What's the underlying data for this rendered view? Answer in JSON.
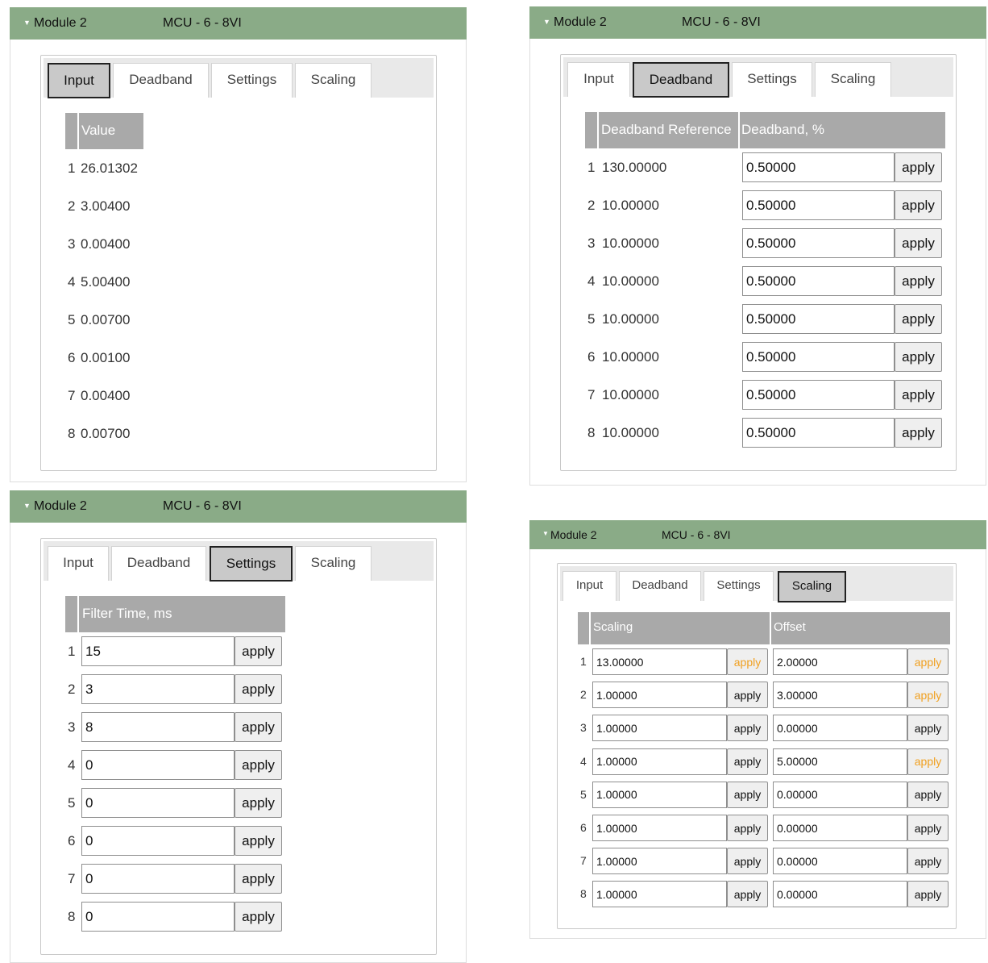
{
  "module_name": "Module 2",
  "module_type": "MCU - 6 - 8VI",
  "tabs": [
    "Input",
    "Deadband",
    "Settings",
    "Scaling"
  ],
  "apply_label": "apply",
  "colors": {
    "header": "#8aab87",
    "table_header": "#a9a9a9",
    "pending_apply": "#f0a020"
  },
  "input_panel": {
    "active_tab": "Input",
    "column": "Value",
    "rows": [
      {
        "n": "1",
        "value": "26.01302"
      },
      {
        "n": "2",
        "value": "3.00400"
      },
      {
        "n": "3",
        "value": "0.00400"
      },
      {
        "n": "4",
        "value": "5.00400"
      },
      {
        "n": "5",
        "value": "0.00700"
      },
      {
        "n": "6",
        "value": "0.00100"
      },
      {
        "n": "7",
        "value": "0.00400"
      },
      {
        "n": "8",
        "value": "0.00700"
      }
    ]
  },
  "deadband_panel": {
    "active_tab": "Deadband",
    "columns": [
      "Deadband Reference",
      "Deadband, %"
    ],
    "rows": [
      {
        "n": "1",
        "reference": "130.00000",
        "deadband": "0.50000"
      },
      {
        "n": "2",
        "reference": "10.00000",
        "deadband": "0.50000"
      },
      {
        "n": "3",
        "reference": "10.00000",
        "deadband": "0.50000"
      },
      {
        "n": "4",
        "reference": "10.00000",
        "deadband": "0.50000"
      },
      {
        "n": "5",
        "reference": "10.00000",
        "deadband": "0.50000"
      },
      {
        "n": "6",
        "reference": "10.00000",
        "deadband": "0.50000"
      },
      {
        "n": "7",
        "reference": "10.00000",
        "deadband": "0.50000"
      },
      {
        "n": "8",
        "reference": "10.00000",
        "deadband": "0.50000"
      }
    ]
  },
  "settings_panel": {
    "active_tab": "Settings",
    "column": "Filter Time, ms",
    "rows": [
      {
        "n": "1",
        "value": "15"
      },
      {
        "n": "2",
        "value": "3"
      },
      {
        "n": "3",
        "value": "8"
      },
      {
        "n": "4",
        "value": "0"
      },
      {
        "n": "5",
        "value": "0"
      },
      {
        "n": "6",
        "value": "0"
      },
      {
        "n": "7",
        "value": "0"
      },
      {
        "n": "8",
        "value": "0"
      }
    ]
  },
  "scaling_panel": {
    "active_tab": "Scaling",
    "columns": [
      "Scaling",
      "Offset"
    ],
    "rows": [
      {
        "n": "1",
        "scaling": "13.00000",
        "scaling_pending": true,
        "offset": "2.00000",
        "offset_pending": true
      },
      {
        "n": "2",
        "scaling": "1.00000",
        "scaling_pending": false,
        "offset": "3.00000",
        "offset_pending": true
      },
      {
        "n": "3",
        "scaling": "1.00000",
        "scaling_pending": false,
        "offset": "0.00000",
        "offset_pending": false
      },
      {
        "n": "4",
        "scaling": "1.00000",
        "scaling_pending": false,
        "offset": "5.00000",
        "offset_pending": true
      },
      {
        "n": "5",
        "scaling": "1.00000",
        "scaling_pending": false,
        "offset": "0.00000",
        "offset_pending": false
      },
      {
        "n": "6",
        "scaling": "1.00000",
        "scaling_pending": false,
        "offset": "0.00000",
        "offset_pending": false
      },
      {
        "n": "7",
        "scaling": "1.00000",
        "scaling_pending": false,
        "offset": "0.00000",
        "offset_pending": false
      },
      {
        "n": "8",
        "scaling": "1.00000",
        "scaling_pending": false,
        "offset": "0.00000",
        "offset_pending": false
      }
    ]
  }
}
